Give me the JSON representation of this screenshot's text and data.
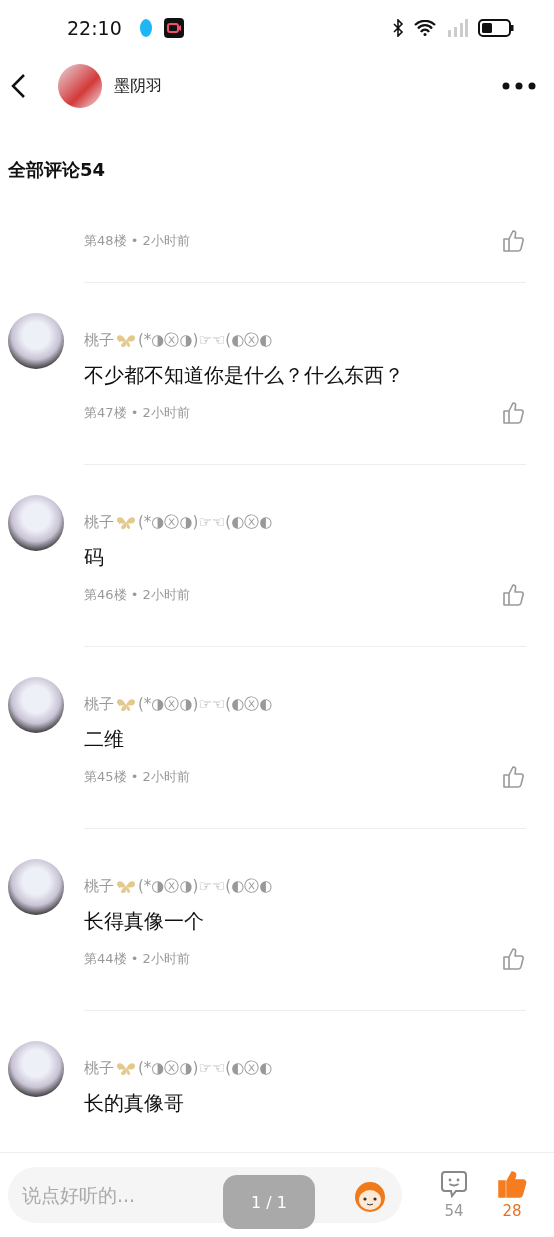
{
  "status_bar": {
    "time": "22:10"
  },
  "header": {
    "title": "墨阴羽"
  },
  "section_title": "全部评论54",
  "comments": [
    {
      "kind": "partial",
      "meta": "第48楼 • 2小时前"
    },
    {
      "kind": "full",
      "name": "桃子",
      "name_suffix": "(*◑ⓧ◑)☞☜(◐ⓧ◐",
      "text": "不少都不知道你是什么？什么东西？",
      "meta": "第47楼 • 2小时前"
    },
    {
      "kind": "full",
      "name": "桃子",
      "name_suffix": "(*◑ⓧ◑)☞☜(◐ⓧ◐",
      "text": "码",
      "meta": "第46楼 • 2小时前"
    },
    {
      "kind": "full",
      "name": "桃子",
      "name_suffix": "(*◑ⓧ◑)☞☜(◐ⓧ◐",
      "text": "二维",
      "meta": "第45楼 • 2小时前"
    },
    {
      "kind": "full",
      "name": "桃子",
      "name_suffix": "(*◑ⓧ◑)☞☜(◐ⓧ◐",
      "text": "长得真像一个",
      "meta": "第44楼 • 2小时前"
    },
    {
      "kind": "cut",
      "name": "桃子",
      "name_suffix": "(*◑ⓧ◑)☞☜(◐ⓧ◐",
      "text": "长的真像哥"
    }
  ],
  "bottom_bar": {
    "placeholder": "说点好听的...",
    "toast": "1 / 1",
    "comment_count": "54",
    "like_count": "28",
    "liked": true
  }
}
